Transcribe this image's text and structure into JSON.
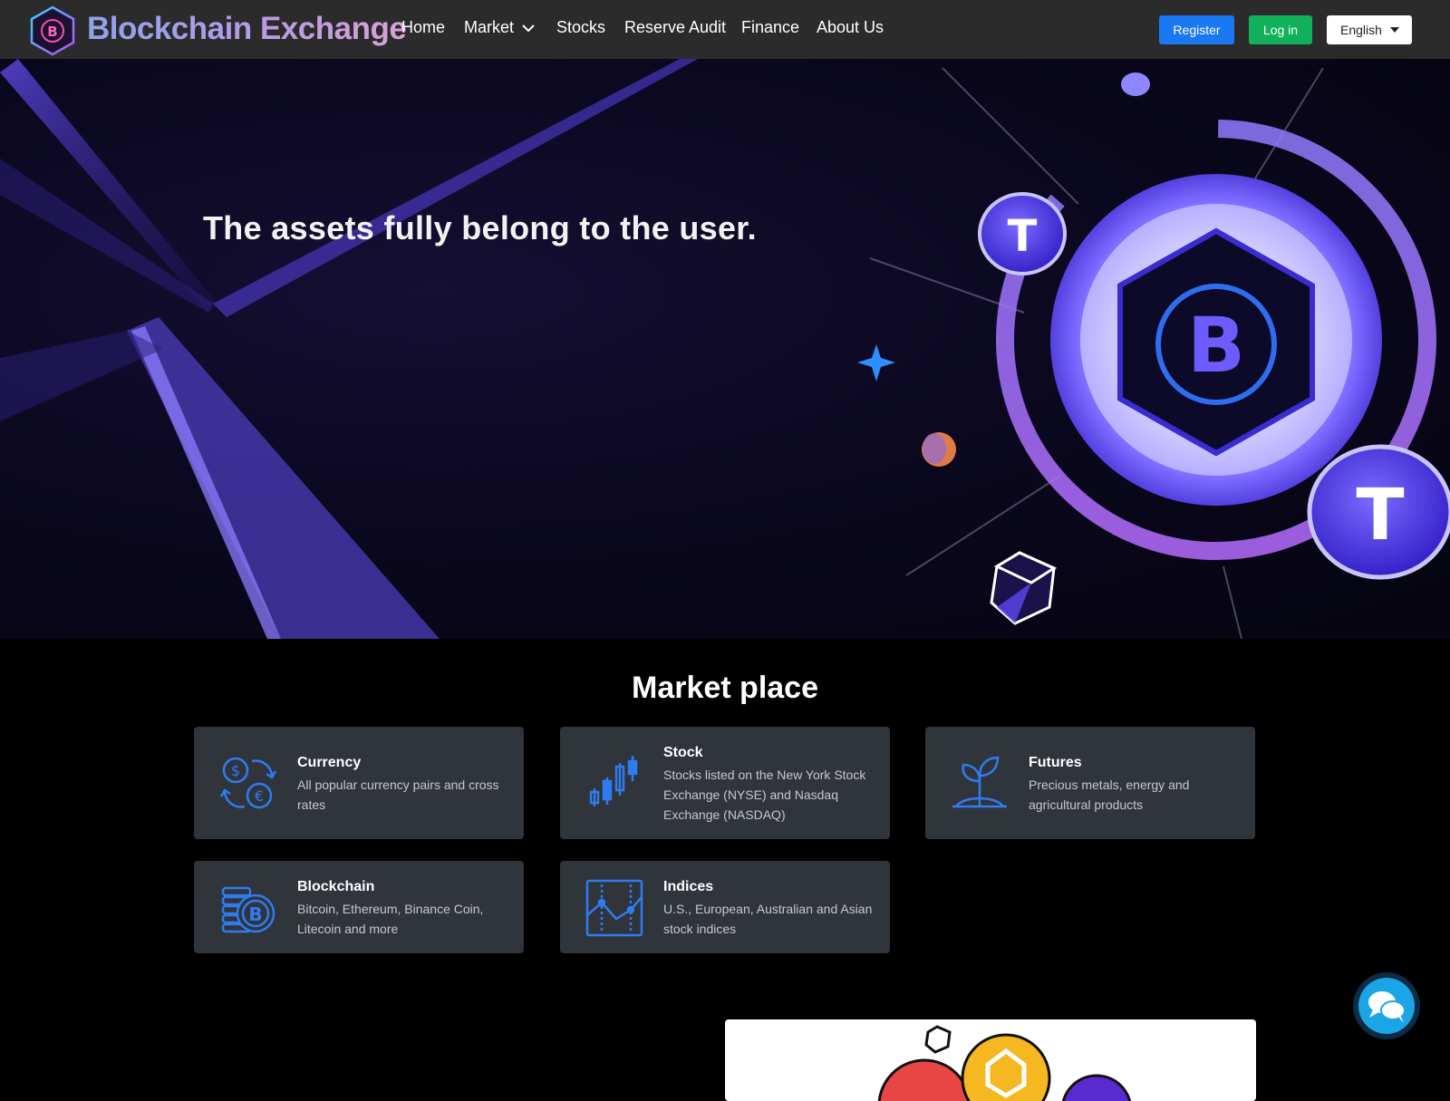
{
  "brand": {
    "name": "Blockchain Exchange",
    "logo_icon": "bitcoin-hexagon-icon"
  },
  "nav": {
    "home": "Home",
    "market": "Market",
    "stocks": "Stocks",
    "reserve_audit": "Reserve Audit",
    "finance": "Finance",
    "about": "About Us"
  },
  "auth": {
    "register": "Register",
    "login": "Log in",
    "language": "English"
  },
  "hero": {
    "title": "The assets fully belong to the user."
  },
  "market": {
    "title": "Market place",
    "cards": [
      {
        "title": "Currency",
        "desc": "All popular currency pairs and cross rates",
        "icon": "currency-exchange-icon"
      },
      {
        "title": "Stock",
        "desc": "Stocks listed on the New York Stock Exchange (NYSE) and Nasdaq Exchange (NASDAQ)",
        "icon": "candlestick-icon"
      },
      {
        "title": "Futures",
        "desc": "Precious metals, energy and agricultural products",
        "icon": "plant-sprout-icon"
      },
      {
        "title": "Blockchain",
        "desc": "Bitcoin, Ethereum, Binance Coin, Litecoin and more",
        "icon": "bitcoin-coins-icon"
      },
      {
        "title": "Indices",
        "desc": "U.S., European, Australian and Asian stock indices",
        "icon": "index-chart-icon"
      }
    ]
  },
  "colors": {
    "accent_blue": "#1a78f2",
    "login_green": "#11b15c",
    "icon_blue": "#2f7cf0",
    "card_bg": "#30343b"
  }
}
